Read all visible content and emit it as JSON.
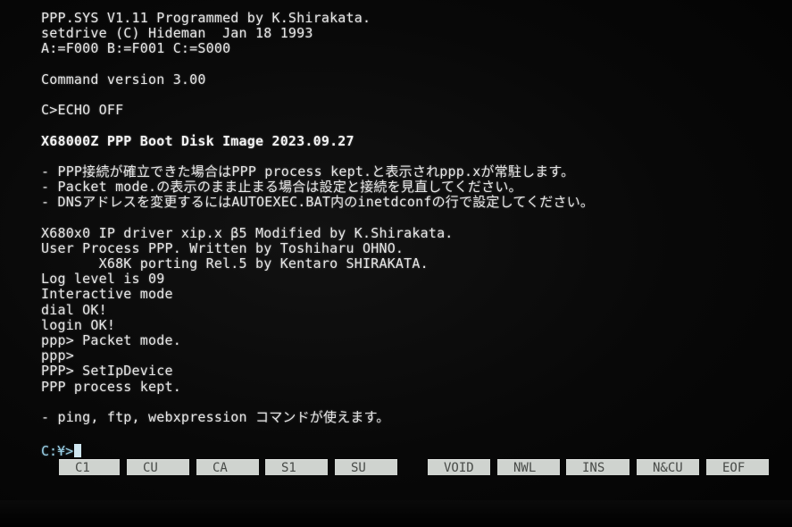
{
  "terminal": {
    "lines": [
      {
        "text": "PPP.SYS V1.11 Programmed by K.Shirakata."
      },
      {
        "text": "setdrive (C) Hideman  Jan 18 1993"
      },
      {
        "text": "A:=F000 B:=F001 C:=S000"
      },
      {
        "text": ""
      },
      {
        "text": "Command version 3.00"
      },
      {
        "text": ""
      },
      {
        "text": "C>ECHO OFF"
      },
      {
        "text": ""
      },
      {
        "text": "X68000Z PPP Boot Disk Image 2023.09.27",
        "bold": true
      },
      {
        "text": ""
      },
      {
        "text": "- PPP接続が確立できた場合はPPP process kept.と表示されppp.xが常駐します。"
      },
      {
        "text": "- Packet mode.の表示のまま止まる場合は設定と接続を見直してください。"
      },
      {
        "text": "- DNSアドレスを変更するにはAUTOEXEC.BAT内のinetdconfの行で設定してください。"
      },
      {
        "text": ""
      },
      {
        "text": "X680x0 IP driver xip.x β5 Modified by K.Shirakata."
      },
      {
        "text": "User Process PPP. Written by Toshiharu OHNO."
      },
      {
        "text": "       X68K porting Rel.5 by Kentaro SHIRAKATA."
      },
      {
        "text": "Log level is 09"
      },
      {
        "text": "Interactive mode"
      },
      {
        "text": "dial OK!"
      },
      {
        "text": "login OK!"
      },
      {
        "text": "ppp> Packet mode."
      },
      {
        "text": "ppp>"
      },
      {
        "text": "PPP> SetIpDevice"
      },
      {
        "text": "PPP process kept."
      },
      {
        "text": ""
      },
      {
        "text": "- ping, ftp, webxpression コマンドが使えます。"
      }
    ],
    "prompt": "C:¥>"
  },
  "function_keys": [
    "C1",
    "CU",
    "CA",
    "S1",
    "SU",
    "VOID",
    "NWL",
    "INS",
    "N&CU",
    "EOF"
  ]
}
